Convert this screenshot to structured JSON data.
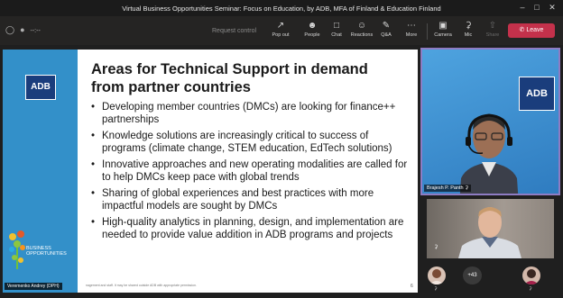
{
  "window": {
    "title": "Virtual Business Opportunities Seminar: Focus on Education, by ADB, MFA of Finland & Education Finland"
  },
  "toolbar": {
    "timer": "--:--",
    "request_control": "Request control",
    "buttons": [
      {
        "label": "Pop out",
        "icon": "pop-out-icon"
      },
      {
        "label": "People",
        "icon": "people-icon"
      },
      {
        "label": "Chat",
        "icon": "chat-icon"
      },
      {
        "label": "Reactions",
        "icon": "reactions-icon"
      },
      {
        "label": "Q&A",
        "icon": "qa-icon"
      },
      {
        "label": "More",
        "icon": "more-icon"
      },
      {
        "label": "Camera",
        "icon": "camera-icon"
      },
      {
        "label": "Mic",
        "icon": "mic-icon"
      },
      {
        "label": "Share",
        "icon": "share-icon"
      }
    ],
    "leave_label": "Leave"
  },
  "slide": {
    "logo": "ADB",
    "title_line1": "Areas for Technical Support in demand",
    "title_line2": "from partner countries",
    "bullets": [
      "Developing member countries (DMCs) are looking for finance++ partnerships",
      "Knowledge solutions are increasingly critical to success of programs (climate change, STEM education, EdTech solutions)",
      "Innovative approaches and new operating modalities are called for to help DMCs keep pace with global trends",
      "Sharing of global experiences and best practices with more impactful models are sought by DMCs",
      "High-quality analytics in planning, design, and implementation are needed to provide value addition in ADB programs and projects"
    ],
    "brand_line1": "BUSINESS",
    "brand_line2": "OPPORTUNITIES",
    "footer": "nagement and staff. It may be shared outside ADB with appropriate permission.",
    "page_number": "6",
    "presenter": "Veremenko Andrey (DPH)"
  },
  "participants": {
    "main_name": "Brajesh P. Panth",
    "main_logo": "ADB",
    "overflow_count": "+43"
  },
  "colors": {
    "leave": "#c4314b",
    "slide_sidebar": "#3390c9",
    "adb_blue": "#1a3d7c"
  }
}
